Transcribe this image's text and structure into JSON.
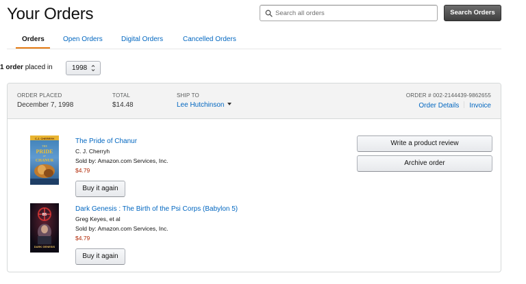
{
  "page": {
    "title": "Your Orders"
  },
  "search": {
    "placeholder": "Search all orders",
    "value": "",
    "button_label": "Search Orders"
  },
  "tabs": [
    {
      "label": "Orders",
      "active": true
    },
    {
      "label": "Open Orders",
      "active": false
    },
    {
      "label": "Digital Orders",
      "active": false
    },
    {
      "label": "Cancelled Orders",
      "active": false
    }
  ],
  "filter": {
    "count_text": "1 order",
    "suffix_text": "placed in",
    "selected_year": "1998"
  },
  "order": {
    "placed_label": "ORDER PLACED",
    "placed_value": "December 7, 1998",
    "total_label": "TOTAL",
    "total_value": "$14.48",
    "ship_to_label": "SHIP TO",
    "ship_to_value": "Lee Hutchinson",
    "order_number_label": "ORDER # 002-2144439-9862655",
    "details_link": "Order Details",
    "invoice_link": "Invoice",
    "actions": {
      "review_label": "Write a product review",
      "archive_label": "Archive order"
    },
    "items": [
      {
        "title": "The Pride of Chanur",
        "author": "C. J. Cherryh",
        "seller": "Sold by: Amazon.com Services, Inc.",
        "price": "$4.79",
        "buy_again_label": "Buy it again",
        "cover_text": "C.J. CHERRYH THE PRIDE OF CHANUR"
      },
      {
        "title": "Dark Genesis : The Birth of the Psi Corps (Babylon 5)",
        "author": "Greg Keyes, et al",
        "seller": "Sold by: Amazon.com Services, Inc.",
        "price": "$4.79",
        "buy_again_label": "Buy it again",
        "cover_text": "BABYLON 5 DARK GENESIS"
      }
    ]
  },
  "colors": {
    "link": "#0066c0",
    "price": "#b12704",
    "tab_accent": "#e47911",
    "search_button": "#3e3e3e"
  },
  "icons": {
    "search": "magnifier-icon",
    "dropdown": "caret-down-icon"
  }
}
